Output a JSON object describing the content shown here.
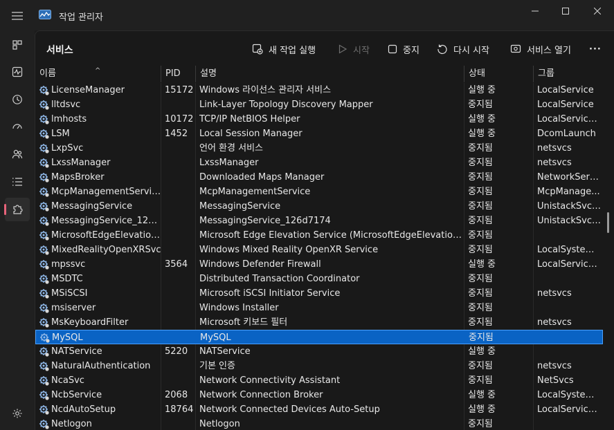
{
  "window": {
    "title": "작업 관리자"
  },
  "page": {
    "title": "서비스"
  },
  "toolbar": {
    "new_task": "새 작업 실행",
    "start": "시작",
    "stop": "중지",
    "restart": "다시 시작",
    "open_services": "서비스 열기",
    "more": "···"
  },
  "columns": {
    "name": "이름",
    "pid": "PID",
    "desc": "설명",
    "status": "상태",
    "group": "그룹"
  },
  "rows": [
    {
      "name": "LicenseManager",
      "pid": "15172",
      "desc": "Windows 라이선스 관리자 서비스",
      "status": "실행 중",
      "group": "LocalService"
    },
    {
      "name": "lltdsvc",
      "pid": "",
      "desc": "Link-Layer Topology Discovery Mapper",
      "status": "중지됨",
      "group": "LocalService"
    },
    {
      "name": "lmhosts",
      "pid": "10172",
      "desc": "TCP/IP NetBIOS Helper",
      "status": "실행 중",
      "group": "LocalService..."
    },
    {
      "name": "LSM",
      "pid": "1452",
      "desc": "Local Session Manager",
      "status": "실행 중",
      "group": "DcomLaunch"
    },
    {
      "name": "LxpSvc",
      "pid": "",
      "desc": "언어 환경 서비스",
      "status": "중지됨",
      "group": "netsvcs"
    },
    {
      "name": "LxssManager",
      "pid": "",
      "desc": "LxssManager",
      "status": "중지됨",
      "group": "netsvcs"
    },
    {
      "name": "MapsBroker",
      "pid": "",
      "desc": "Downloaded Maps Manager",
      "status": "중지됨",
      "group": "NetworkServi..."
    },
    {
      "name": "McpManagementService",
      "pid": "",
      "desc": "McpManagementService",
      "status": "중지됨",
      "group": "McpManage..."
    },
    {
      "name": "MessagingService",
      "pid": "",
      "desc": "MessagingService",
      "status": "중지됨",
      "group": "UnistackSvcG..."
    },
    {
      "name": "MessagingService_126d...",
      "pid": "",
      "desc": "MessagingService_126d7174",
      "status": "중지됨",
      "group": "UnistackSvcG..."
    },
    {
      "name": "MicrosoftEdgeElevationS...",
      "pid": "",
      "desc": "Microsoft Edge Elevation Service (MicrosoftEdgeElevationSer...",
      "status": "중지됨",
      "group": ""
    },
    {
      "name": "MixedRealityOpenXRSvc",
      "pid": "",
      "desc": "Windows Mixed Reality OpenXR Service",
      "status": "중지됨",
      "group": "LocalSystem..."
    },
    {
      "name": "mpssvc",
      "pid": "3564",
      "desc": "Windows Defender Firewall",
      "status": "실행 중",
      "group": "LocalService..."
    },
    {
      "name": "MSDTC",
      "pid": "",
      "desc": "Distributed Transaction Coordinator",
      "status": "중지됨",
      "group": ""
    },
    {
      "name": "MSiSCSI",
      "pid": "",
      "desc": "Microsoft iSCSI Initiator Service",
      "status": "중지됨",
      "group": "netsvcs"
    },
    {
      "name": "msiserver",
      "pid": "",
      "desc": "Windows Installer",
      "status": "중지됨",
      "group": ""
    },
    {
      "name": "MsKeyboardFilter",
      "pid": "",
      "desc": "Microsoft 키보드 필터",
      "status": "중지됨",
      "group": "netsvcs"
    },
    {
      "name": "MySQL",
      "pid": "",
      "desc": "MySQL",
      "status": "중지됨",
      "group": "",
      "selected": true
    },
    {
      "name": "NATService",
      "pid": "5220",
      "desc": "NATService",
      "status": "실행 중",
      "group": ""
    },
    {
      "name": "NaturalAuthentication",
      "pid": "",
      "desc": "기본 인증",
      "status": "중지됨",
      "group": "netsvcs"
    },
    {
      "name": "NcaSvc",
      "pid": "",
      "desc": "Network Connectivity Assistant",
      "status": "중지됨",
      "group": "NetSvcs"
    },
    {
      "name": "NcbService",
      "pid": "2068",
      "desc": "Network Connection Broker",
      "status": "실행 중",
      "group": "LocalSystem..."
    },
    {
      "name": "NcdAutoSetup",
      "pid": "18764",
      "desc": "Network Connected Devices Auto-Setup",
      "status": "실행 중",
      "group": "LocalService..."
    },
    {
      "name": "Netlogon",
      "pid": "",
      "desc": "Netlogon",
      "status": "중지됨",
      "group": ""
    }
  ]
}
